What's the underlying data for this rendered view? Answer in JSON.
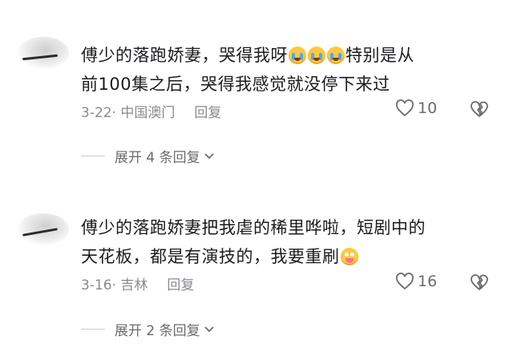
{
  "comments": [
    {
      "text_before": "傅少的落跑娇妻，哭得我呀",
      "emojis": [
        "loudly-crying-face",
        "loudly-crying-face",
        "loudly-crying-face"
      ],
      "text_after_line1": "特别是从",
      "text_line2": "前100集之后，哭得我感觉就没停下来过",
      "date_location": "3-22· 中国澳门",
      "reply_label": "回复",
      "like_count": "10",
      "expand_label": "展开 4 条回复"
    },
    {
      "text_line1": "傅少的落跑娇妻把我虐的稀里哗啦，短剧中的",
      "text_line2_before": "天花板，都是有演技的，我要重刷",
      "emoji": "hugging-face",
      "date_location": "3-16· 吉林",
      "reply_label": "回复",
      "like_count": "16",
      "expand_label": "展开 2 条回复"
    }
  ]
}
